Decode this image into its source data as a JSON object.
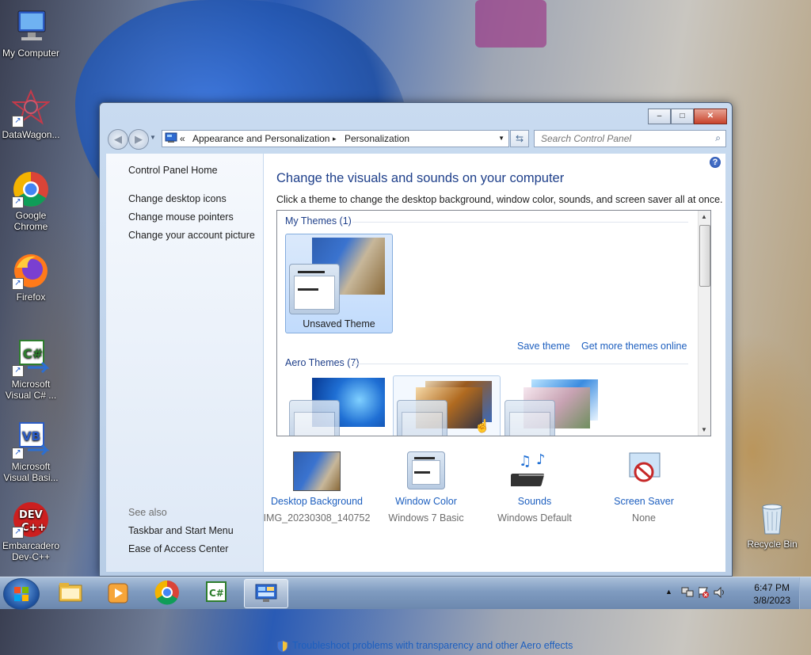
{
  "desktop": {
    "icons": [
      {
        "label": "My Computer",
        "icon": "computer-icon"
      },
      {
        "label": "DataWagon...",
        "icon": "datawagon-icon"
      },
      {
        "label": "Google Chrome",
        "icon": "chrome-icon"
      },
      {
        "label": "Firefox",
        "icon": "firefox-icon"
      },
      {
        "label": "Microsoft Visual C# ...",
        "icon": "visual-csharp-icon"
      },
      {
        "label": "Microsoft Visual Basi...",
        "icon": "visual-basic-icon"
      },
      {
        "label": "Embarcadero Dev-C++",
        "icon": "devcpp-icon"
      },
      {
        "label": "Recycle Bin",
        "icon": "recycle-bin-icon"
      }
    ]
  },
  "window": {
    "title_buttons": {
      "minimize": "–",
      "maximize": "□",
      "close": "✕"
    },
    "nav": {
      "back": "◀",
      "forward": "▶"
    },
    "address": {
      "prefix": "«",
      "crumb1": "Appearance and Personalization",
      "sep": "▸",
      "crumb2": "Personalization"
    },
    "search": {
      "placeholder": "Search Control Panel"
    }
  },
  "left_pane": {
    "home": "Control Panel Home",
    "links": [
      "Change desktop icons",
      "Change mouse pointers",
      "Change your account picture"
    ],
    "see_also_label": "See also",
    "see_also": [
      "Taskbar and Start Menu",
      "Ease of Access Center"
    ]
  },
  "main": {
    "title": "Change the visuals and sounds on your computer",
    "subtitle": "Click a theme to change the desktop background, window color, sounds, and screen saver all at once.",
    "my_themes_label": "My Themes (1)",
    "unsaved_theme": "Unsaved Theme",
    "save_theme": "Save theme",
    "get_more_themes": "Get more themes online",
    "aero_themes_label": "Aero Themes (7)",
    "settings": [
      {
        "label": "Desktop Background",
        "value": "IMG_20230308_140752"
      },
      {
        "label": "Window Color",
        "value": "Windows 7 Basic"
      },
      {
        "label": "Sounds",
        "value": "Windows Default"
      },
      {
        "label": "Screen Saver",
        "value": "None"
      }
    ],
    "troubleshoot": "Troubleshoot problems with transparency and other Aero effects"
  },
  "taskbar": {
    "clock_time": "6:47 PM",
    "clock_date": "3/8/2023"
  }
}
